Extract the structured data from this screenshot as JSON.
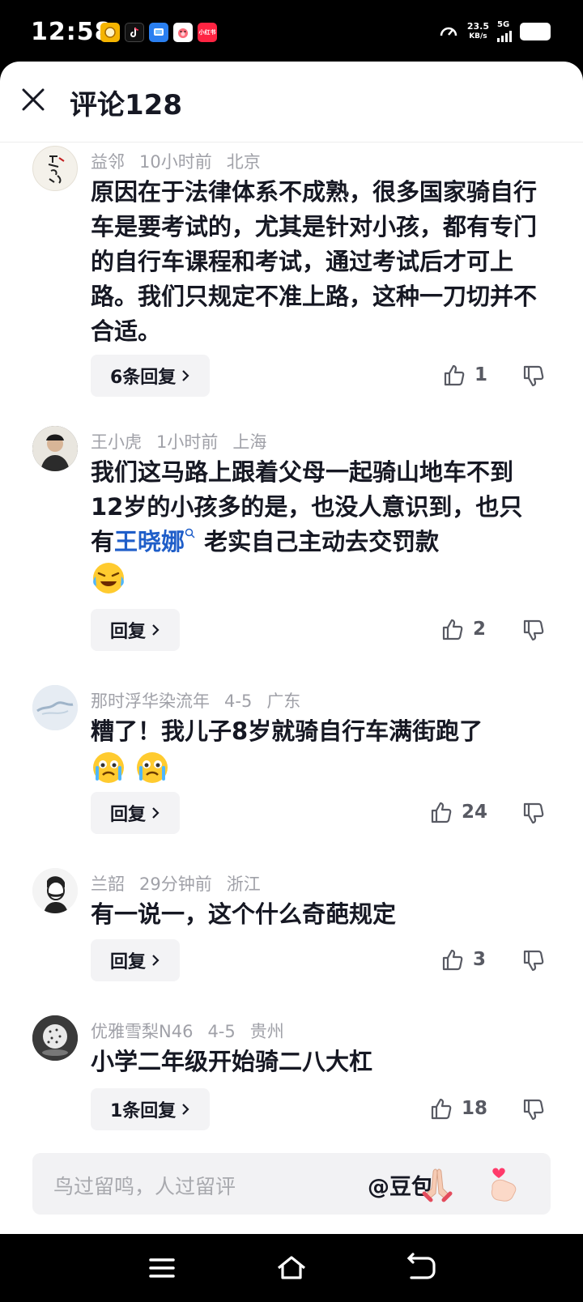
{
  "status_bar": {
    "time": "12:58",
    "network_speed_value": "23.5",
    "network_speed_unit": "KB/s",
    "network_type": "5G",
    "notification_apps": [
      {
        "name": "coin-app-icon",
        "color": "#f5b400",
        "label": ""
      },
      {
        "name": "tiktok-icon",
        "color": "#111111",
        "label": ""
      },
      {
        "name": "message-app-icon",
        "color": "#2a7ff0",
        "label": ""
      },
      {
        "name": "pig-app-icon",
        "color": "#e8463b",
        "label": ""
      },
      {
        "name": "xiaohongshu-icon",
        "color": "#ff2442",
        "label": "小红书"
      }
    ]
  },
  "header": {
    "title": "评论128"
  },
  "comments": [
    {
      "username": "益邻",
      "time": "10小时前",
      "location": "北京",
      "text": "原因在于法律体系不成熟，很多国家骑自行车是要考试的，尤其是针对小孩，都有专门的自行车课程和考试，通过考试后才可上路。我们只规定不准上路，这种一刀切并不合适。",
      "reply_label": "6条回复",
      "likes": "1"
    },
    {
      "username": "王小虎",
      "time": "1小时前",
      "location": "上海",
      "text_before": "我们这马路上跟着父母一起骑山地车不到12岁的小孩多的是，也没人意识到，也只有",
      "mention": "王晓娜",
      "text_after": " 老实自己主动去交罚款",
      "reply_label": "回复",
      "likes": "2"
    },
    {
      "username": "那时浮华染流年",
      "time": "4-5",
      "location": "广东",
      "text": "糟了！我儿子8岁就骑自行车满街跑了",
      "reply_label": "回复",
      "likes": "24"
    },
    {
      "username": "兰韶",
      "time": "29分钟前",
      "location": "浙江",
      "text": "有一说一，这个什么奇葩规定",
      "reply_label": "回复",
      "likes": "3"
    },
    {
      "username": "优雅雪梨N46",
      "time": "4-5",
      "location": "贵州",
      "text": "小学二年级开始骑二八大杠",
      "reply_label": "1条回复",
      "likes": "18"
    }
  ],
  "input_bar": {
    "placeholder": "鸟过留鸣，人过留评",
    "mention_label": "@豆包"
  },
  "colors": {
    "text_primary": "#161823",
    "text_secondary": "#a0a1a8",
    "mention": "#1f5ec9",
    "reply_bg": "#f3f3f5"
  }
}
